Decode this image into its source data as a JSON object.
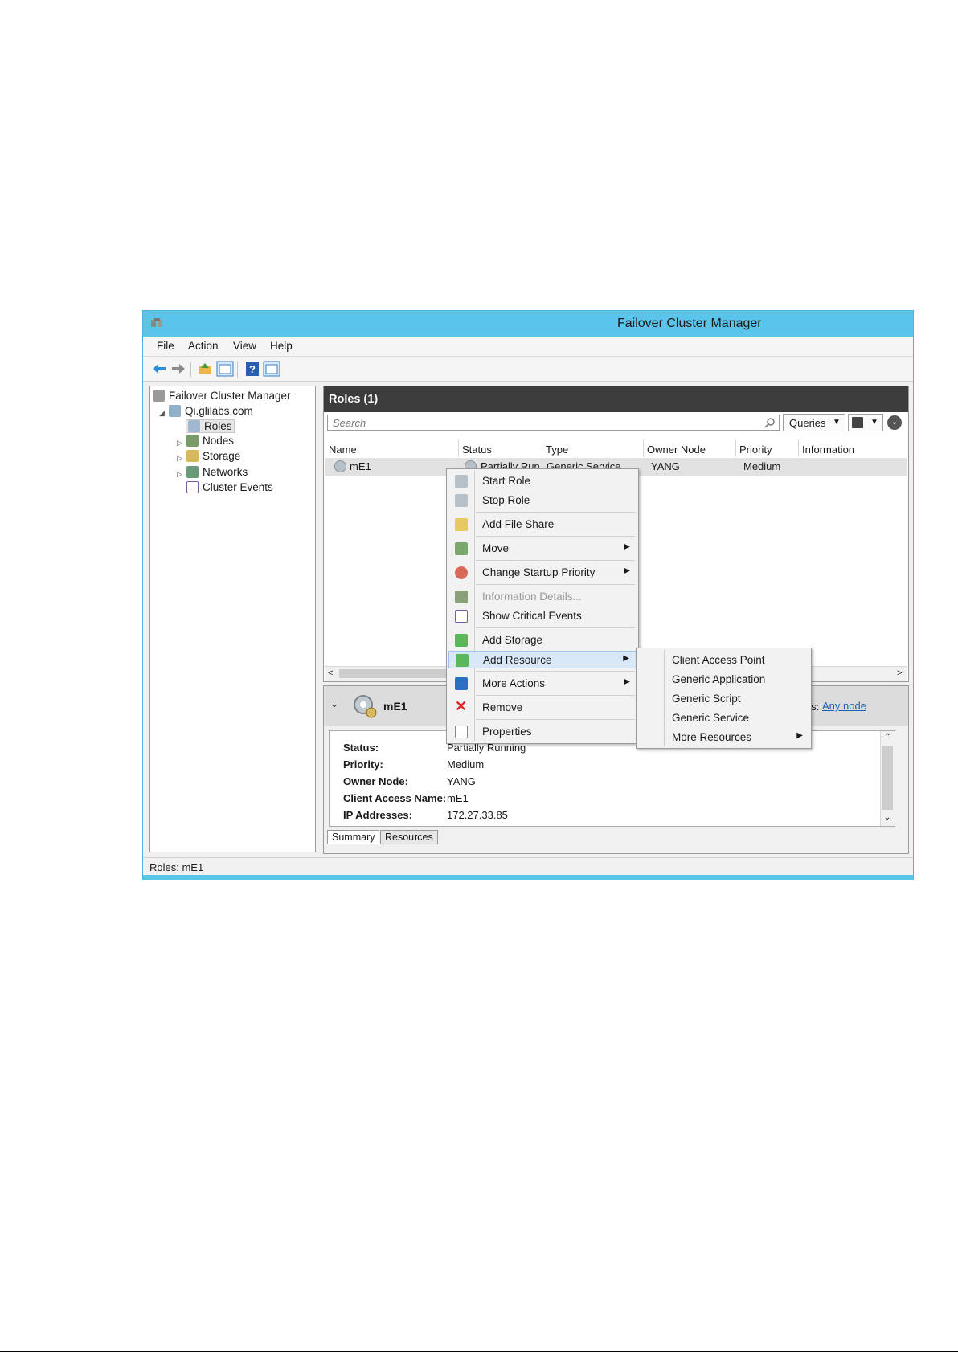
{
  "window": {
    "title": "Failover Cluster Manager"
  },
  "menu": [
    "File",
    "Action",
    "View",
    "Help"
  ],
  "toolbar": {
    "icons": [
      "back-arrow-icon",
      "forward-arrow-icon",
      "up-folder-icon",
      "show-hide-tree-icon",
      "help-icon",
      "action-pane-icon"
    ]
  },
  "tree": {
    "root": "Failover Cluster Manager",
    "cluster": "Qi.glilabs.com",
    "items": [
      "Roles",
      "Nodes",
      "Storage",
      "Networks",
      "Cluster Events"
    ]
  },
  "roles": {
    "header": "Roles (1)",
    "search_placeholder": "Search",
    "queries_label": "Queries",
    "columns": [
      "Name",
      "Status",
      "Type",
      "Owner Node",
      "Priority",
      "Information"
    ],
    "rows": [
      {
        "name": "mE1",
        "status": "Partially Run",
        "type": "Generic Service",
        "owner": "YANG",
        "priority": "Medium",
        "info": ""
      }
    ]
  },
  "detail": {
    "name": "mE1",
    "owners_label": "Owners:",
    "owners_value": "Any node",
    "fields": [
      {
        "label": "Status:",
        "value": "Partially Running"
      },
      {
        "label": "Priority:",
        "value": "Medium"
      },
      {
        "label": "Owner Node:",
        "value": "YANG"
      },
      {
        "label": "Client Access Name:",
        "value": "mE1"
      },
      {
        "label": "IP Addresses:",
        "value": "172.27.33.85"
      }
    ],
    "tabs": [
      "Summary",
      "Resources"
    ]
  },
  "context_menu": {
    "items": [
      {
        "label": "Start Role",
        "icon": "start-role-icon"
      },
      {
        "label": "Stop Role",
        "icon": "stop-role-icon"
      },
      {
        "label": "Add File Share",
        "icon": "file-share-icon"
      },
      {
        "label": "Move",
        "icon": "move-icon",
        "submenu": true
      },
      {
        "label": "Change Startup Priority",
        "icon": "priority-icon",
        "submenu": true
      },
      {
        "label": "Information Details...",
        "icon": "info-details-icon",
        "disabled": true
      },
      {
        "label": "Show Critical Events",
        "icon": "critical-events-icon"
      },
      {
        "label": "Add Storage",
        "icon": "add-storage-icon"
      },
      {
        "label": "Add Resource",
        "icon": "add-resource-icon",
        "submenu": true,
        "highlighted": true
      },
      {
        "label": "More Actions",
        "icon": "more-actions-icon",
        "submenu": true
      },
      {
        "label": "Remove",
        "icon": "remove-icon"
      },
      {
        "label": "Properties",
        "icon": "properties-icon"
      }
    ]
  },
  "submenu": {
    "items": [
      {
        "label": "Client Access Point"
      },
      {
        "label": "Generic Application"
      },
      {
        "label": "Generic Script"
      },
      {
        "label": "Generic Service"
      },
      {
        "label": "More Resources",
        "submenu": true
      }
    ]
  },
  "statusbar": {
    "text": "Roles:  mE1"
  },
  "colors": {
    "titlebar": "#5bc4ea",
    "header_dark": "#3c3c3c",
    "highlight": "#d8e8f8",
    "link": "#1a5fb4",
    "remove_red": "#d92b2b"
  }
}
